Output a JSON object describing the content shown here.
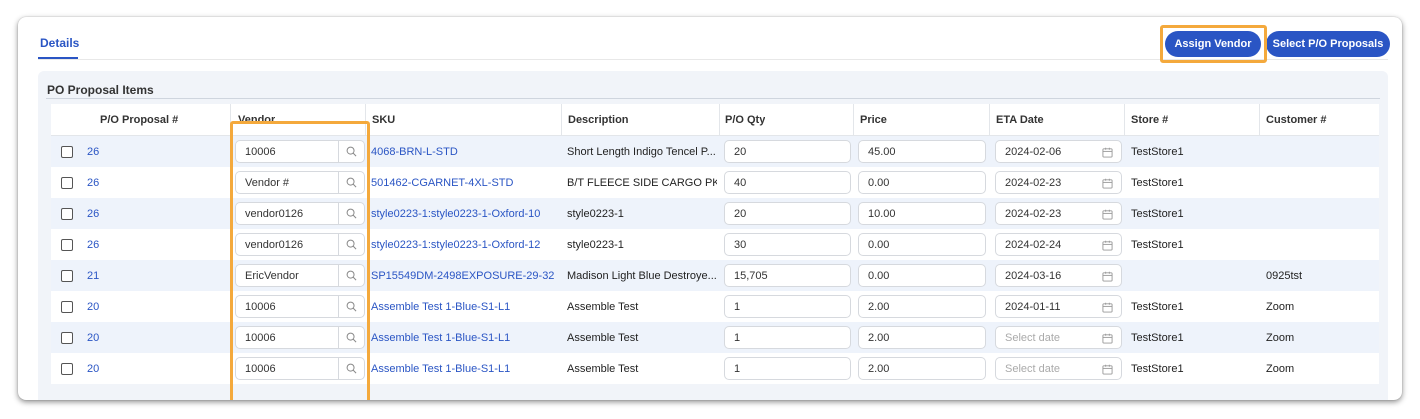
{
  "tabs": {
    "details": "Details"
  },
  "toolbar": {
    "assign_vendor": "Assign Vendor",
    "select_proposals": "Select P/O Proposals"
  },
  "section": {
    "title": "PO Proposal Items"
  },
  "columns": {
    "proposal": "P/O Proposal #",
    "vendor": "Vendor",
    "sku": "SKU",
    "description": "Description",
    "qty": "P/O Qty",
    "price": "Price",
    "eta": "ETA Date",
    "store": "Store #",
    "customer": "Customer #"
  },
  "placeholders": {
    "vendor": "Vendor #",
    "date": "Select date"
  },
  "rows": [
    {
      "proposal": "26",
      "vendor": "10006",
      "sku": "4068-BRN-L-STD",
      "description": "Short Length Indigo Tencel P...",
      "qty": "20",
      "price": "45.00",
      "eta": "2024-02-06",
      "store": "TestStore1",
      "customer": ""
    },
    {
      "proposal": "26",
      "vendor": "",
      "sku": "501462-CGARNET-4XL-STD",
      "description": "B/T FLEECE SIDE CARGO PKT ...",
      "qty": "40",
      "price": "0.00",
      "eta": "2024-02-23",
      "store": "TestStore1",
      "customer": ""
    },
    {
      "proposal": "26",
      "vendor": "vendor0126",
      "sku": "style0223-1:style0223-1-Oxford-10",
      "description": "style0223-1",
      "qty": "20",
      "price": "10.00",
      "eta": "2024-02-23",
      "store": "TestStore1",
      "customer": ""
    },
    {
      "proposal": "26",
      "vendor": "vendor0126",
      "sku": "style0223-1:style0223-1-Oxford-12",
      "description": "style0223-1",
      "qty": "30",
      "price": "0.00",
      "eta": "2024-02-24",
      "store": "TestStore1",
      "customer": ""
    },
    {
      "proposal": "21",
      "vendor": "EricVendor",
      "sku": "SP15549DM-2498EXPOSURE-29-32",
      "description": "Madison Light Blue Destroye...",
      "qty": "15,705",
      "price": "0.00",
      "eta": "2024-03-16",
      "store": "",
      "customer": "0925tst"
    },
    {
      "proposal": "20",
      "vendor": "10006",
      "sku": "Assemble Test 1-Blue-S1-L1",
      "description": "Assemble Test",
      "qty": "1",
      "price": "2.00",
      "eta": "2024-01-11",
      "store": "TestStore1",
      "customer": "Zoom"
    },
    {
      "proposal": "20",
      "vendor": "10006",
      "sku": "Assemble Test 1-Blue-S1-L1",
      "description": "Assemble Test",
      "qty": "1",
      "price": "2.00",
      "eta": "",
      "store": "TestStore1",
      "customer": "Zoom"
    },
    {
      "proposal": "20",
      "vendor": "10006",
      "sku": "Assemble Test 1-Blue-S1-L1",
      "description": "Assemble Test",
      "qty": "1",
      "price": "2.00",
      "eta": "",
      "store": "TestStore1",
      "customer": "Zoom"
    }
  ],
  "colors": {
    "accent": "#2a55c4",
    "highlight": "#f4a93c",
    "row_alt": "#eef3fb"
  }
}
